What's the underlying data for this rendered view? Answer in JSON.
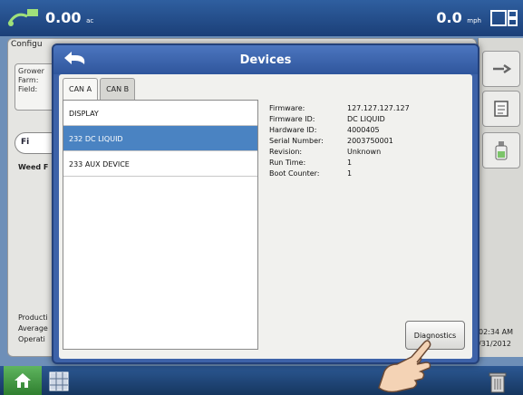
{
  "status_bar": {
    "speed_left_value": "0.00",
    "speed_left_unit": "ac",
    "speed_right_value": "0.0",
    "speed_right_unit": "mph"
  },
  "background": {
    "config_label": "Configu",
    "grower_label": "Grower",
    "farm_label": "Farm:",
    "field_label": "Field:",
    "field_button_label": "Fi",
    "weed_label": "Weed F",
    "bottom_lines": [
      "Producti",
      "Average",
      "Operati"
    ],
    "time": "02:34 AM",
    "date": "/31/2012"
  },
  "modal": {
    "title": "Devices",
    "tabs": [
      {
        "label": "CAN A",
        "active": true
      },
      {
        "label": "CAN B",
        "active": false
      }
    ],
    "devices": [
      {
        "name": "DISPLAY",
        "selected": false
      },
      {
        "name": "232 DC LIQUID",
        "selected": true
      },
      {
        "name": "233 AUX DEVICE",
        "selected": false
      }
    ],
    "info": [
      {
        "label": "Firmware:",
        "value": "127.127.127.127"
      },
      {
        "label": "Firmware ID:",
        "value": "DC LIQUID"
      },
      {
        "label": "Hardware ID:",
        "value": "4000405"
      },
      {
        "label": "Serial Number:",
        "value": "2003750001"
      },
      {
        "label": "Revision:",
        "value": "Unknown"
      },
      {
        "label": "Run Time:",
        "value": "1"
      },
      {
        "label": "Boot Counter:",
        "value": "1"
      }
    ],
    "diagnostics_label": "Diagnostics"
  },
  "colors": {
    "header_blue": "#3d62a8",
    "selected_row": "#4a83c2",
    "home_green": "#4a9f4a"
  }
}
